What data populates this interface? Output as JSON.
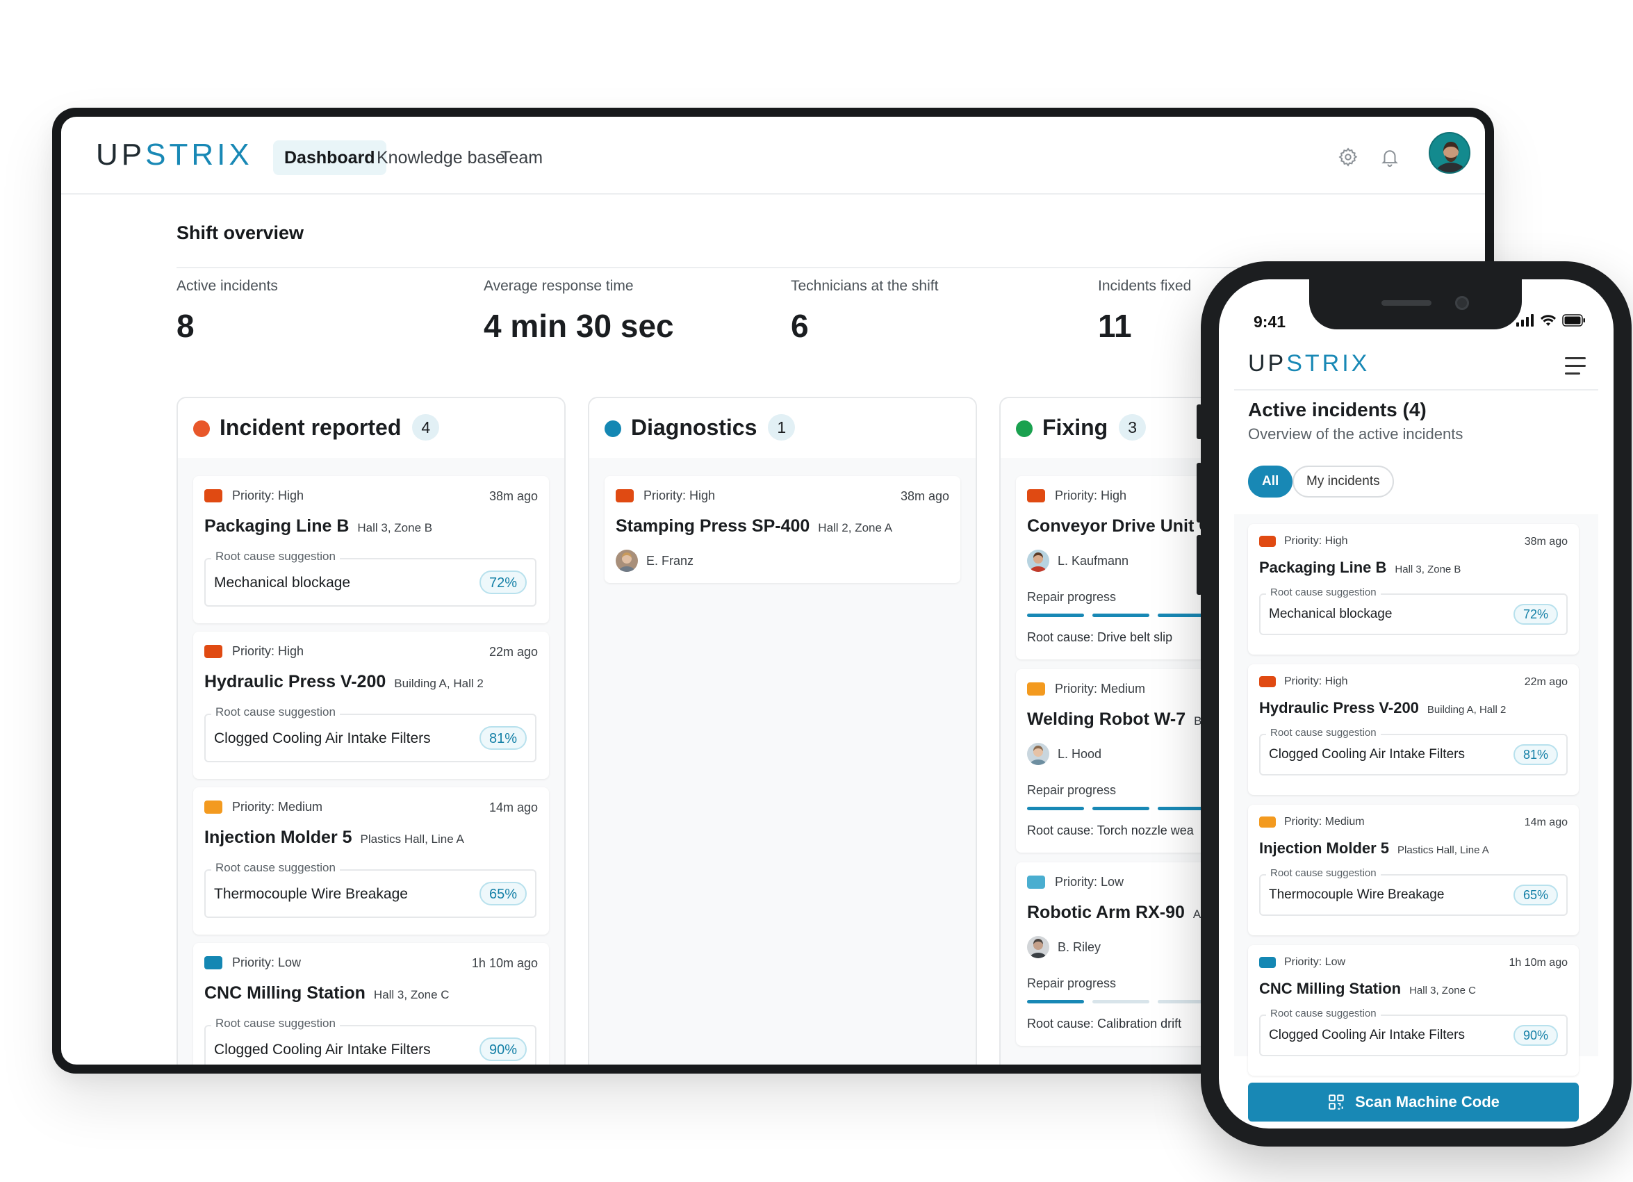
{
  "desktop": {
    "logo": {
      "part1": "UP",
      "part2": "STRIX"
    },
    "nav": [
      {
        "label": "Dashboard",
        "active": true
      },
      {
        "label": "Knowledge base",
        "active": false
      },
      {
        "label": "Team",
        "active": false
      }
    ],
    "icons": {
      "settings": "gear-icon",
      "notifications": "bell-icon",
      "avatar": "user-avatar"
    },
    "section_title": "Shift overview",
    "stats": [
      {
        "label": "Active incidents",
        "value": "8"
      },
      {
        "label": "Average response time",
        "value": "4 min 30 sec"
      },
      {
        "label": "Technicians at the shift",
        "value": "6"
      },
      {
        "label": "Incidents fixed",
        "value": "11"
      }
    ],
    "columns": [
      {
        "title": "Incident reported",
        "count": "4",
        "dot_color": "#e8572a",
        "cards": [
          {
            "priority": "Priority: High",
            "priority_color": "#e04a12",
            "ago": "38m ago",
            "name": "Packaging Line B",
            "location": "Hall 3, Zone B",
            "rc_label": "Root cause suggestion",
            "rc_text": "Mechanical blockage",
            "pct": "72%"
          },
          {
            "priority": "Priority: High",
            "priority_color": "#e04a12",
            "ago": "22m ago",
            "name": "Hydraulic Press V-200",
            "location": "Building A, Hall 2",
            "rc_label": "Root cause suggestion",
            "rc_text": "Clogged Cooling Air Intake Filters",
            "pct": "81%"
          },
          {
            "priority": "Priority: Medium",
            "priority_color": "#f39a1f",
            "ago": "14m ago",
            "name": "Injection Molder 5",
            "location": "Plastics Hall, Line A",
            "rc_label": "Root cause suggestion",
            "rc_text": "Thermocouple Wire Breakage",
            "pct": "65%"
          },
          {
            "priority": "Priority: Low",
            "priority_color": "#1487b3",
            "ago": "1h 10m ago",
            "name": "CNC Milling Station",
            "location": "Hall 3, Zone C",
            "rc_label": "Root cause suggestion",
            "rc_text": "Clogged Cooling Air Intake Filters",
            "pct": "90%"
          }
        ]
      },
      {
        "title": "Diagnostics",
        "count": "1",
        "dot_color": "#1487b3",
        "cards": [
          {
            "priority": "Priority: High",
            "priority_color": "#e04a12",
            "ago": "38m ago",
            "name": "Stamping Press SP-400",
            "location": "Hall 2, Zone A",
            "technician": "E. Franz"
          }
        ]
      },
      {
        "title": "Fixing",
        "count": "3",
        "dot_color": "#1aa14f",
        "cards": [
          {
            "priority": "Priority: High",
            "priority_color": "#e04a12",
            "name": "Conveyor Drive Unit C",
            "technician": "L. Kaufmann",
            "progress_label": "Repair progress",
            "progress": "3 of 3+ segments",
            "root_cause": "Root cause:  Drive belt slip"
          },
          {
            "priority": "Priority: Medium",
            "priority_color": "#f39a1f",
            "name": "Welding Robot W-7",
            "location": "Bo",
            "technician": "L. Hood",
            "progress_label": "Repair progress",
            "progress": "3 of 3+ segments",
            "root_cause": "Root cause:  Torch nozzle wea"
          },
          {
            "priority": "Priority: Low",
            "priority_color": "#4aaed0",
            "name": "Robotic Arm RX-90",
            "location": "As",
            "technician": "B. Riley",
            "progress_label": "Repair progress",
            "progress": "1 of 4 segments",
            "root_cause": "Root cause: Calibration drift"
          }
        ]
      }
    ]
  },
  "mobile": {
    "time": "9:41",
    "logo": {
      "part1": "UP",
      "part2": "STRIX"
    },
    "menu_icon": "hamburger-icon",
    "title": "Active incidents (4)",
    "subtitle": "Overview of the active incidents",
    "filters": [
      {
        "label": "All",
        "active": true
      },
      {
        "label": "My incidents",
        "active": false
      }
    ],
    "cards": [
      {
        "priority": "Priority: High",
        "priority_color": "#e04a12",
        "ago": "38m ago",
        "name": "Packaging Line B",
        "location": "Hall 3, Zone B",
        "rc_label": "Root cause suggestion",
        "rc_text": "Mechanical blockage",
        "pct": "72%"
      },
      {
        "priority": "Priority: High",
        "priority_color": "#e04a12",
        "ago": "22m ago",
        "name": "Hydraulic Press V-200",
        "location": "Building A, Hall 2",
        "rc_label": "Root cause suggestion",
        "rc_text": "Clogged Cooling Air Intake Filters",
        "pct": "81%"
      },
      {
        "priority": "Priority: Medium",
        "priority_color": "#f39a1f",
        "ago": "14m ago",
        "name": "Injection Molder 5",
        "location": "Plastics Hall, Line A",
        "rc_label": "Root cause suggestion",
        "rc_text": "Thermocouple Wire Breakage",
        "pct": "65%"
      },
      {
        "priority": "Priority: Low",
        "priority_color": "#1487b3",
        "ago": "1h 10m ago",
        "name": "CNC Milling Station",
        "location": "Hall 3, Zone C",
        "rc_label": "Root cause suggestion",
        "rc_text": "Clogged Cooling Air Intake Filters",
        "pct": "90%"
      }
    ],
    "scan_button": "Scan Machine Code",
    "scan_icon": "qr-code-icon"
  }
}
